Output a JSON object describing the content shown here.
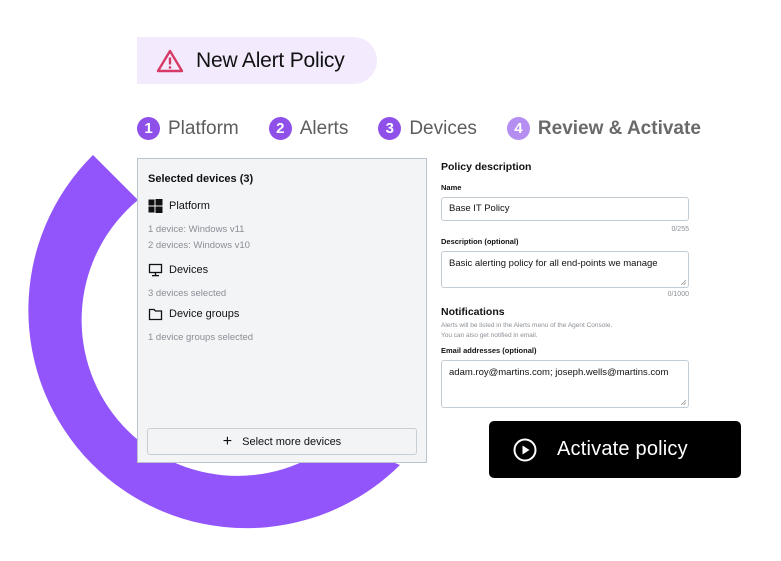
{
  "header": {
    "title": "New Alert Policy",
    "icon": "warning-triangle-icon"
  },
  "steps": [
    {
      "number": "1",
      "label": "Platform",
      "active": false
    },
    {
      "number": "2",
      "label": "Alerts",
      "active": false
    },
    {
      "number": "3",
      "label": "Devices",
      "active": false
    },
    {
      "number": "4",
      "label": "Review & Activate",
      "active": true
    }
  ],
  "selected_devices": {
    "title": "Selected devices (3)",
    "platform": {
      "label": "Platform",
      "icon": "windows-icon",
      "lines": [
        "1 device: Windows v11",
        "2 devices: Windows v10"
      ]
    },
    "devices": {
      "label": "Devices",
      "icon": "monitor-icon",
      "lines": [
        "3 devices selected"
      ]
    },
    "device_groups": {
      "label": "Device groups",
      "icon": "folder-icon",
      "lines": [
        "1 device groups selected"
      ]
    },
    "select_more_label": "Select more devices"
  },
  "policy": {
    "section_title": "Policy description",
    "name_label": "Name",
    "name_value": "Base IT Policy",
    "name_counter": "0/255",
    "description_label": "Description (optional)",
    "description_value": "Basic alerting policy for all end-points we manage",
    "description_counter": "0/1000"
  },
  "notifications": {
    "section_title": "Notifications",
    "help_line1": "Alerts will be listed in the Alerts menu of the Agent Console.",
    "help_line2": "You can also get notified in email.",
    "email_label": "Email addresses (optional)",
    "email_value": "adam.roy@martins.com; joseph.wells@martins.com"
  },
  "activate_button": {
    "label": "Activate policy",
    "icon": "play-circle-icon"
  },
  "colors": {
    "accent_purple": "#9155fb",
    "step_badge": "#8f50ea",
    "step_badge_active": "#b48ef0",
    "warning": "#d63b66",
    "title_pill_bg": "#f3ebfd"
  }
}
